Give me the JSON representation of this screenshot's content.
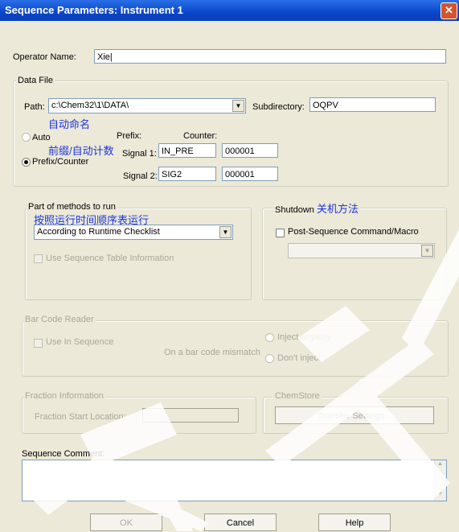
{
  "window": {
    "title": "Sequence Parameters: Instrument 1",
    "close_glyph": "✕"
  },
  "operator": {
    "label": "Operator Name:",
    "value": "Xie|"
  },
  "data_file": {
    "group_title": "Data File",
    "path_label": "Path:",
    "path_value": "c:\\Chem32\\1\\DATA\\",
    "subdir_label": "Subdirectory:",
    "subdir_value": "OQPV",
    "annotation_auto": "自动命名",
    "auto_label": "Auto",
    "annotation_prefix": "前缀/自动计数",
    "prefix_counter_label": "Prefix/Counter",
    "prefix_header": "Prefix:",
    "counter_header": "Counter:",
    "signal1_label": "Signal 1:",
    "signal1_prefix": "IN_PRE",
    "signal1_counter": "000001",
    "signal2_label": "Signal 2:",
    "signal2_prefix": "SIG2",
    "signal2_counter": "000001"
  },
  "methods": {
    "group_title": "Part of methods to run",
    "annotation": "按照运行时间顺序表运行",
    "selected": "According to Runtime Checklist",
    "use_seq_table": "Use Sequence Table Information"
  },
  "shutdown": {
    "group_title": "Shutdown",
    "annotation": "关机方法",
    "post_seq_label": "Post-Sequence Command/Macro"
  },
  "barcode": {
    "group_title": "Bar Code Reader",
    "use_in_seq": "Use In Sequence",
    "mismatch_label": "On a bar code mismatch",
    "inject_anyway": "Inject anyway",
    "dont_inject": "Don't inject"
  },
  "fraction": {
    "group_title": "Fraction Information",
    "start_label": "Fraction Start Location:"
  },
  "chemstore": {
    "group_title": "ChemStore",
    "transfer_button": "Transfer Settings..."
  },
  "comment": {
    "label": "Sequence Comment:"
  },
  "buttons": {
    "ok": "OK",
    "cancel": "Cancel",
    "help": "Help"
  }
}
